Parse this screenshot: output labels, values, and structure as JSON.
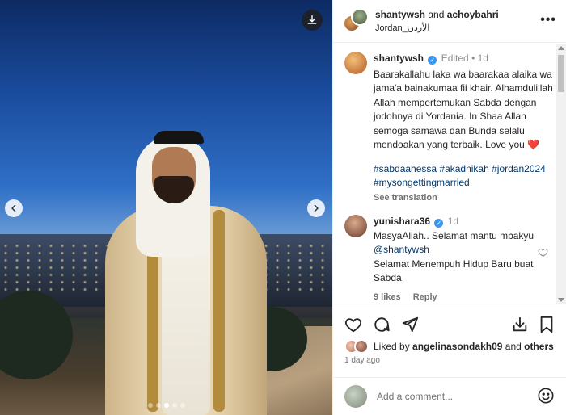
{
  "media": {
    "download_icon": "download-icon",
    "prev_icon": "chevron-left-icon",
    "next_icon": "chevron-right-icon",
    "carousel": {
      "total": 5,
      "active_index": 2
    }
  },
  "header": {
    "user1": "shantywsh",
    "joiner": "and",
    "user2": "achoybahri",
    "location": "Jordan_الأردن",
    "more_icon": "more-horizontal-icon"
  },
  "caption": {
    "username": "shantywsh",
    "edited": "Edited",
    "sep": "•",
    "time": "1d",
    "text": "Baarakallahu laka wa baarakaa alaika wa jama'a bainakumaa fii khair. Alhamdulillah Allah mempertemukan Sabda dengan jodohnya di Yordania. In Shaa Allah semoga samawa dan Bunda selalu mendoakan yang terbaik. Love you",
    "emoji": "❤️",
    "hashtags": "#sabdaahessa #akadnikah #jordan2024 #mysongettingmarried",
    "see_translation": "See translation"
  },
  "comments": [
    {
      "username": "yunishara36",
      "time": "1d",
      "text_before": "MasyaAllah.. Selamat mantu mbakyu ",
      "mention": "@shantywsh",
      "text_after": "Selamat Menempuh Hidup Baru buat Sabda",
      "likes": "9 likes",
      "reply": "Reply"
    }
  ],
  "actions": {
    "like_icon": "heart-icon",
    "comment_icon": "comment-icon",
    "share_icon": "share-icon",
    "save_icon": "bookmark-icon",
    "download_icon": "download-icon"
  },
  "likes": {
    "prefix": "Liked by",
    "user": "angelinasondakh09",
    "and": "and",
    "others": "others"
  },
  "time_ago": "1 day ago",
  "add_comment": {
    "placeholder": "Add a comment...",
    "emoji_icon": "smiley-icon"
  },
  "colors": {
    "link": "#00376b",
    "verified": "#3897f0",
    "heart": "#ed4956",
    "muted": "#737373"
  }
}
